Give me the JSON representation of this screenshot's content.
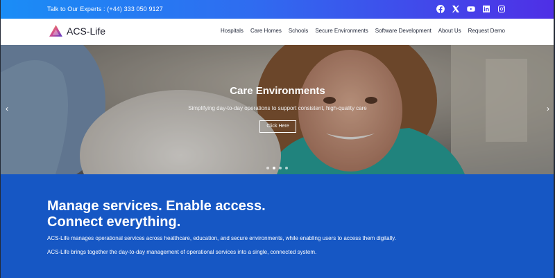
{
  "topbar": {
    "contact_label": "Talk to Our Experts :",
    "phone": "(+44) 333 050 9127",
    "social_icons": [
      "facebook-icon",
      "x-icon",
      "youtube-icon",
      "linkedin-icon",
      "instagram-icon"
    ]
  },
  "nav": {
    "logo_text": "ACS-Life",
    "items": [
      {
        "label": "Hospitals"
      },
      {
        "label": "Care Homes"
      },
      {
        "label": "Schools"
      },
      {
        "label": "Secure Environments"
      },
      {
        "label": "Software Development"
      },
      {
        "label": "About Us"
      },
      {
        "label": "Request Demo"
      }
    ]
  },
  "hero": {
    "title": "Care Environments",
    "subtitle": "Simplifying day-to-day operations to support consistent, high-quality care",
    "button_label": "Click Here",
    "prev_glyph": "‹",
    "next_glyph": "›",
    "slide_count": 4,
    "active_slide": 2
  },
  "intro": {
    "headline_line1": "Manage services. Enable access.",
    "headline_line2": "Connect everything.",
    "paragraph1": "ACS-Life manages operational services across healthcare, education, and secure environments, while enabling users to access them digitally.",
    "paragraph2": "ACS-Life brings together the day-to-day management of operational services into a single, connected system."
  },
  "colors": {
    "topbar_start": "#1a8df6",
    "topbar_end": "#4f2fe6",
    "blue_section": "#1657c4",
    "text_dark": "#22283a"
  }
}
